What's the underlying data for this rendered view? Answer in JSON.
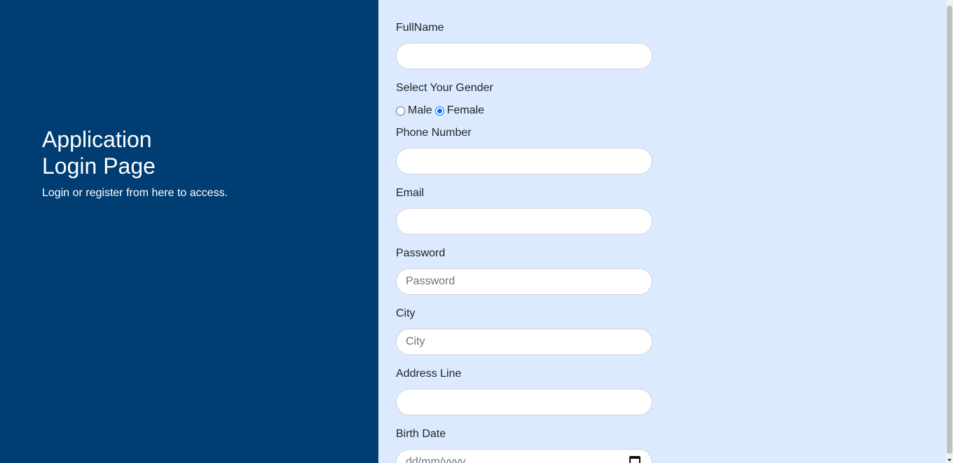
{
  "sidebar": {
    "title_line1": "Application",
    "title_line2": "Login Page",
    "subtitle": "Login or register from here to access."
  },
  "form": {
    "fullname_label": "FullName",
    "fullname_value": "",
    "gender_label": "Select Your Gender",
    "gender_options": [
      "Male",
      "Female"
    ],
    "gender_selected": "Female",
    "phone_label": "Phone Number",
    "phone_value": "",
    "email_label": "Email",
    "email_value": "",
    "password_label": "Password",
    "password_placeholder": "Password",
    "city_label": "City",
    "city_placeholder": "City",
    "address_label": "Address Line",
    "address_value": "",
    "birthdate_label": "Birth Date",
    "birthdate_placeholder": "dd/mm/yyyy"
  },
  "colors": {
    "sidebar_bg": "#003d73",
    "main_bg": "#dbeafe",
    "radio_accent": "#0075ff"
  },
  "icons": {
    "calendar": "calendar-icon"
  }
}
